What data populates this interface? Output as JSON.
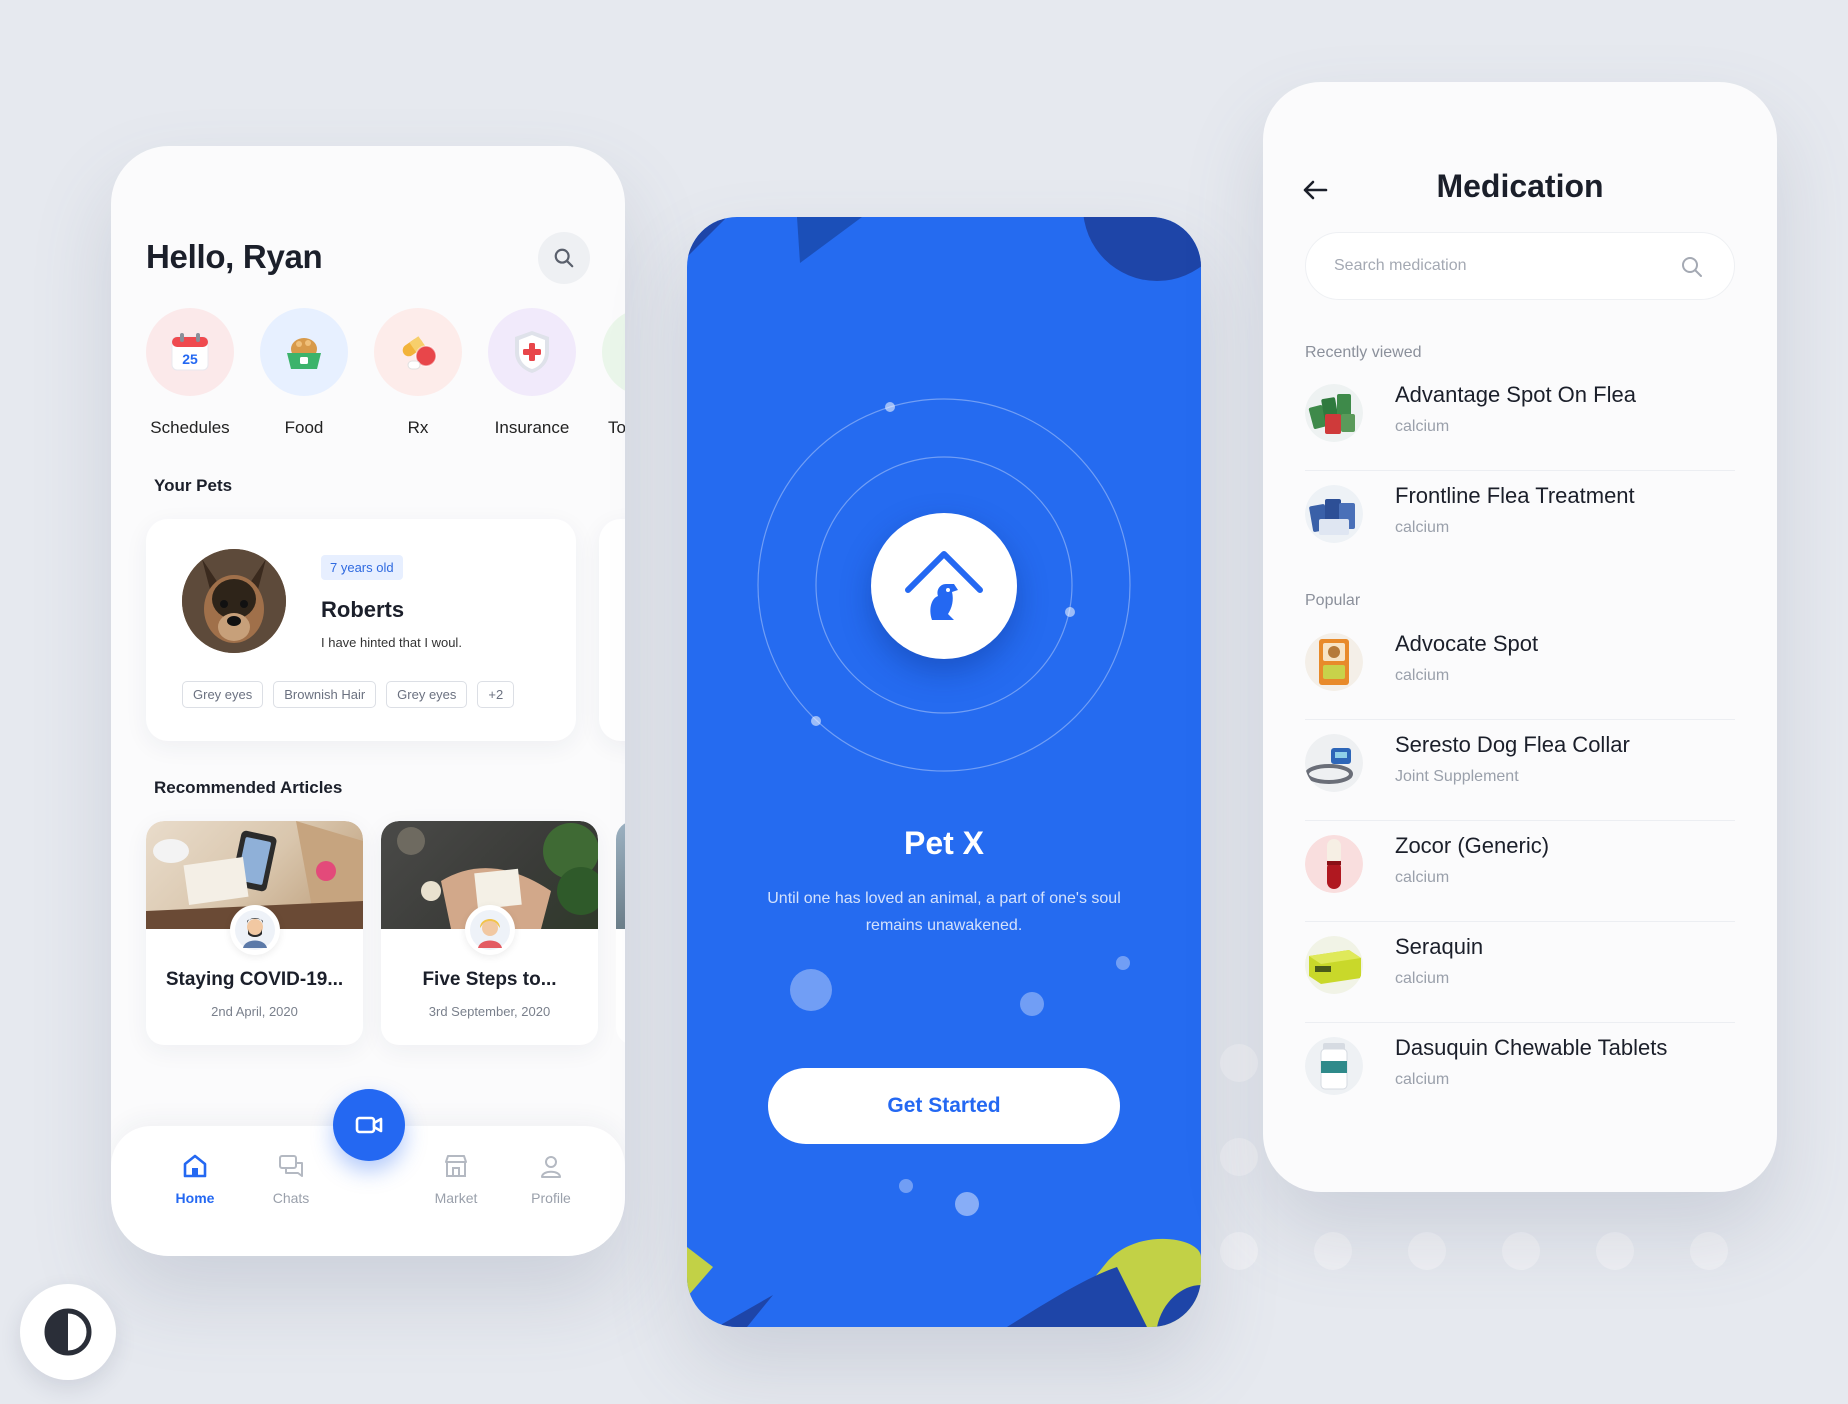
{
  "home": {
    "greeting": "Hello, Ryan",
    "categories": [
      {
        "label": "Schedules",
        "icon": "calendar-icon",
        "bg": "#fbe9ea",
        "day": "25"
      },
      {
        "label": "Food",
        "icon": "food-bowl-icon",
        "bg": "#e7f0ff"
      },
      {
        "label": "Rx",
        "icon": "pills-icon",
        "bg": "#fdecea"
      },
      {
        "label": "Insurance",
        "icon": "shield-cross-icon",
        "bg": "#f1eafb"
      },
      {
        "label": "To",
        "icon": "more-category-icon",
        "bg": "#eaf6ea"
      }
    ],
    "your_pets_title": "Your Pets",
    "pet": {
      "age": "7 years old",
      "name": "Roberts",
      "description": "I have hinted that I woul.",
      "tags": [
        "Grey eyes",
        "Brownish Hair",
        "Grey eyes",
        "+2"
      ]
    },
    "recommended_title": "Recommended Articles",
    "articles": [
      {
        "title": "Staying COVID-19...",
        "date": "2nd April, 2020"
      },
      {
        "title": "Five Steps to...",
        "date": "3rd September, 2020"
      }
    ],
    "tabs": [
      {
        "label": "Home",
        "icon": "home-icon",
        "active": true
      },
      {
        "label": "Chats",
        "icon": "chat-icon",
        "active": false
      },
      {
        "label": "Market",
        "icon": "store-icon",
        "active": false
      },
      {
        "label": "Profile",
        "icon": "user-icon",
        "active": false
      }
    ],
    "fab_icon": "video-icon"
  },
  "splash": {
    "title": "Pet X",
    "subtitle": "Until one has loved an animal, a part of one's soul remains unawakened.",
    "cta": "Get Started",
    "logo_icon": "house-dog-icon"
  },
  "meds": {
    "title": "Medication",
    "search_placeholder": "Search medication",
    "recent_label": "Recently viewed",
    "popular_label": "Popular",
    "recent": [
      {
        "name": "Advantage Spot On Flea",
        "sub": "calcium"
      },
      {
        "name": "Frontline Flea Treatment",
        "sub": "calcium"
      }
    ],
    "popular": [
      {
        "name": "Advocate Spot",
        "sub": "calcium"
      },
      {
        "name": "Seresto Dog Flea Collar",
        "sub": "Joint Supplement"
      },
      {
        "name": "Zocor (Generic)",
        "sub": "calcium"
      },
      {
        "name": "Seraquin",
        "sub": "calcium"
      },
      {
        "name": "Dasuquin Chewable Tablets",
        "sub": "calcium"
      }
    ]
  },
  "colors": {
    "accent": "#2468f2",
    "splash_bg": "#256bf0",
    "lime": "#c2d146"
  }
}
